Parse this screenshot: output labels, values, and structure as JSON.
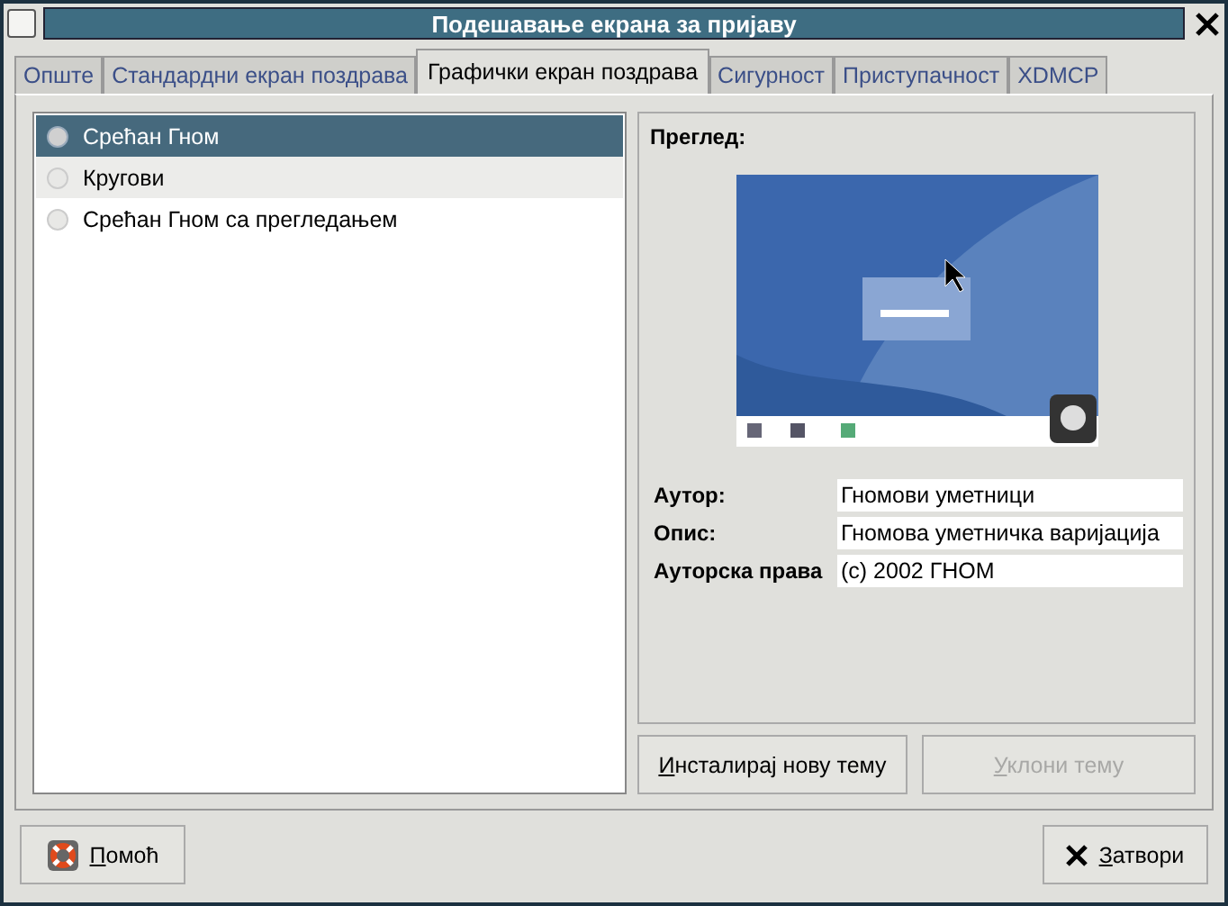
{
  "window": {
    "title": "Подешавање екрана за пријаву"
  },
  "tabs": [
    {
      "label": "Опште",
      "selected": false
    },
    {
      "label": "Стандардни екран поздрава",
      "selected": false
    },
    {
      "label": "Графички екран поздрава",
      "selected": true
    },
    {
      "label": "Сигурност",
      "selected": false
    },
    {
      "label": "Приступачност",
      "selected": false
    },
    {
      "label": "XDMCP",
      "selected": false
    }
  ],
  "themes": [
    {
      "name": "Срећан Гном",
      "selected": true
    },
    {
      "name": "Кругови",
      "selected": false
    },
    {
      "name": "Срећан Гном са прегледањем",
      "selected": false
    }
  ],
  "preview": {
    "label": "Преглед:"
  },
  "details": [
    {
      "label": "Аутор:",
      "value": "Гномови уметници"
    },
    {
      "label": "Опис:",
      "value": "Гномова уметничка варијација"
    },
    {
      "label": "Ауторска права",
      "value": "(c) 2002 ГНОМ"
    }
  ],
  "theme_buttons": [
    {
      "label": "Инсталирај нову тему",
      "disabled": false,
      "mnemonic_underlined": true
    },
    {
      "label": "Уклони тему",
      "disabled": true,
      "mnemonic_underlined": true
    }
  ],
  "footer_buttons": [
    {
      "label": "Помоћ",
      "kind": "help",
      "mnemonic_underlined": true
    },
    {
      "label": "Затвори",
      "kind": "close",
      "mnemonic_underlined": true
    }
  ]
}
